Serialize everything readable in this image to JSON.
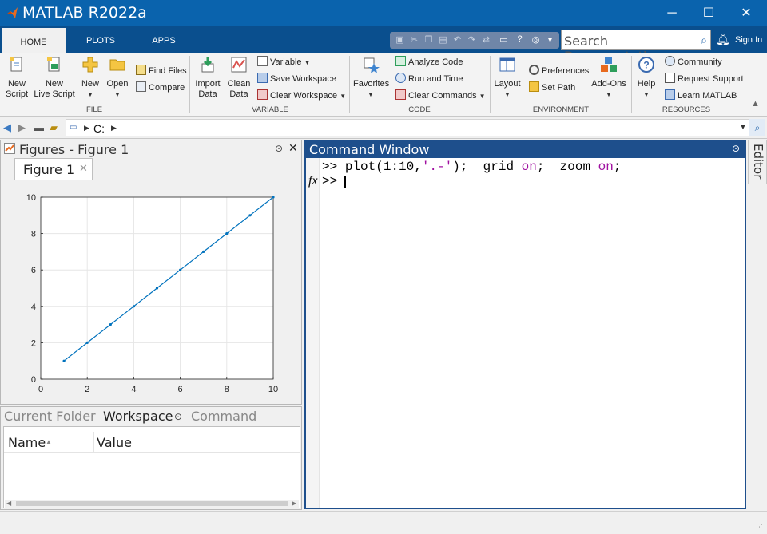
{
  "window": {
    "title": "MATLAB R2022a",
    "controls": [
      "─",
      "☐",
      "✕"
    ]
  },
  "ribbon_tabs": [
    "HOME",
    "PLOTS",
    "APPS"
  ],
  "search": {
    "placeholder": "Search Documentation"
  },
  "account": {
    "signin": "Sign In"
  },
  "ribbon": {
    "file": {
      "label": "FILE",
      "new_script": [
        "New",
        "Script"
      ],
      "new_live_script": [
        "New",
        "Live Script"
      ],
      "new": "New",
      "open": "Open",
      "find_files": "Find Files",
      "compare": "Compare"
    },
    "variable": {
      "label": "VARIABLE",
      "import_data": [
        "Import",
        "Data"
      ],
      "clean_data": [
        "Clean",
        "Data"
      ],
      "variable": "Variable",
      "save_workspace": "Save Workspace",
      "clear_workspace": "Clear Workspace"
    },
    "code": {
      "label": "CODE",
      "favorites": "Favorites",
      "analyze_code": "Analyze Code",
      "run_and_time": "Run and Time",
      "clear_commands": "Clear Commands"
    },
    "environment": {
      "label": "ENVIRONMENT",
      "layout": "Layout",
      "preferences": "Preferences",
      "set_path": "Set Path",
      "addons": "Add-Ons"
    },
    "resources": {
      "label": "RESOURCES",
      "help": "Help",
      "community": "Community",
      "request_support": "Request Support",
      "learn_matlab": "Learn MATLAB"
    }
  },
  "address": {
    "path": "C:"
  },
  "figures_panel": {
    "title": "Figures - Figure 1",
    "tab": "Figure 1"
  },
  "chart_data": {
    "type": "line",
    "x": [
      1,
      2,
      3,
      4,
      5,
      6,
      7,
      8,
      9,
      10
    ],
    "series": [
      {
        "values": [
          1,
          2,
          3,
          4,
          5,
          6,
          7,
          8,
          9,
          10
        ],
        "color": "#0072bd"
      }
    ],
    "xlim": [
      0,
      10
    ],
    "ylim": [
      0,
      10
    ],
    "xticks": [
      0,
      2,
      4,
      6,
      8,
      10
    ],
    "yticks": [
      0,
      2,
      4,
      6,
      8,
      10
    ],
    "grid": true,
    "title": "",
    "xlabel": "",
    "ylabel": ""
  },
  "workspace_panel": {
    "tabs": [
      "Current Folder",
      "Workspace",
      "Command History"
    ],
    "columns": [
      "Name",
      "Value"
    ]
  },
  "command_window": {
    "title": "Command Window",
    "line1": {
      "prompt": ">> ",
      "cmd": "plot(1:10,",
      "str": "'.-'",
      "cmd2": ");  grid ",
      "kw1": "on",
      "cmd3": ";  zoom ",
      "kw2": "on",
      "cmd4": ";"
    },
    "line2_prompt": ">> ",
    "fx": "fx"
  },
  "editor_tab": "Editor"
}
